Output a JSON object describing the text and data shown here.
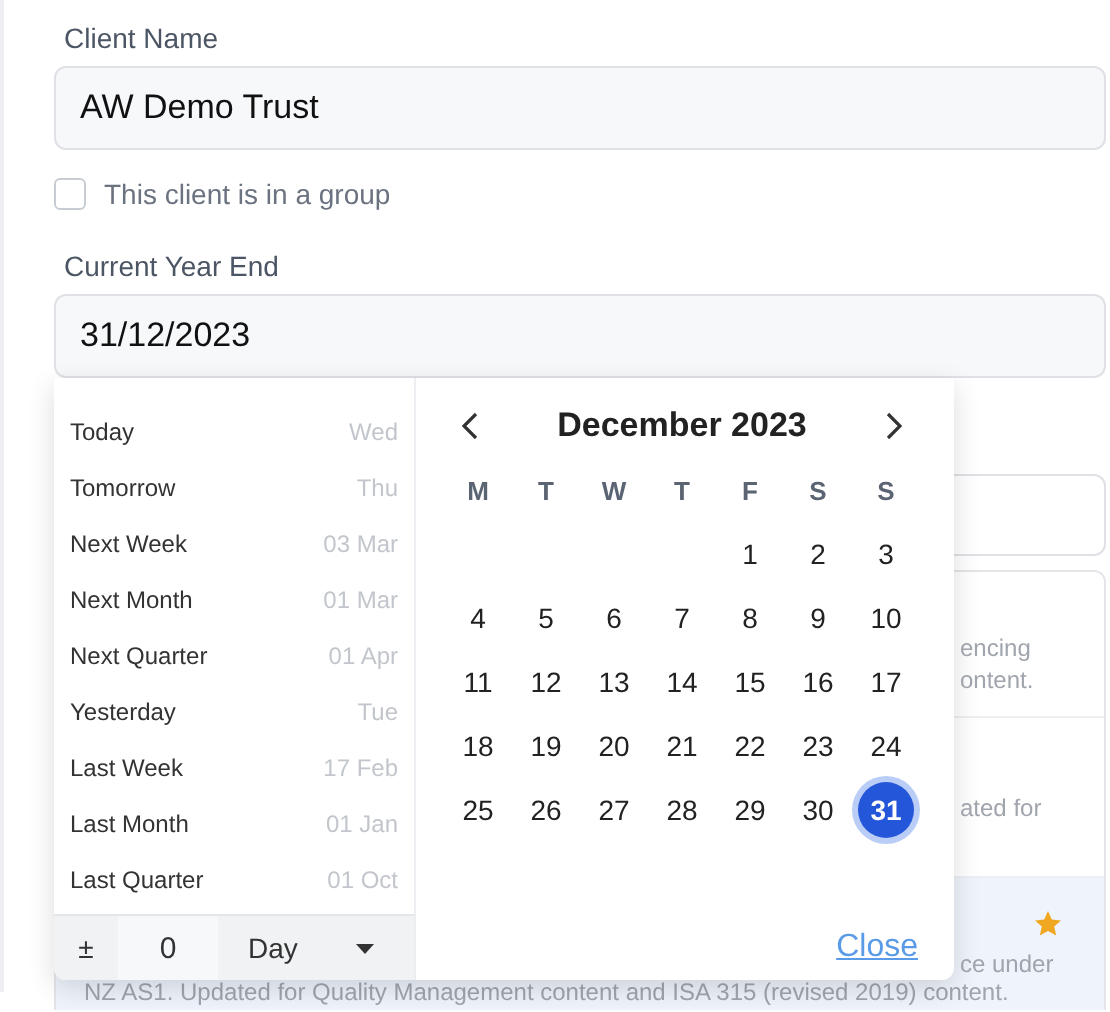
{
  "client_name": {
    "label": "Client Name",
    "value": "AW Demo Trust"
  },
  "group_checkbox": {
    "label": "This client is in a group",
    "checked": false
  },
  "year_end": {
    "label": "Current Year End",
    "value": "31/12/2023"
  },
  "cards": [
    {
      "texts": [
        "encing",
        "ontent."
      ],
      "highlighted": false,
      "starred": false
    },
    {
      "texts": [
        "ated for"
      ],
      "highlighted": false,
      "starred": false
    },
    {
      "texts": [
        "ce under"
      ],
      "note": "NZ AS1. Updated for Quality Management content and ISA 315 (revised 2019) content.",
      "highlighted": true,
      "starred": true
    }
  ],
  "datepicker": {
    "shortcuts": [
      {
        "label": "Today",
        "hint": "Wed"
      },
      {
        "label": "Tomorrow",
        "hint": "Thu"
      },
      {
        "label": "Next Week",
        "hint": "03 Mar"
      },
      {
        "label": "Next Month",
        "hint": "01 Mar"
      },
      {
        "label": "Next Quarter",
        "hint": "01 Apr"
      },
      {
        "label": "Yesterday",
        "hint": "Tue"
      },
      {
        "label": "Last Week",
        "hint": "17 Feb"
      },
      {
        "label": "Last Month",
        "hint": "01 Jan"
      },
      {
        "label": "Last Quarter",
        "hint": "01 Oct"
      }
    ],
    "offset": {
      "sign": "±",
      "amount": "0",
      "unit": "Day"
    },
    "month_title": "December 2023",
    "weekdays": [
      "M",
      "T",
      "W",
      "T",
      "F",
      "S",
      "S"
    ],
    "weeks": [
      [
        {
          "day": "1",
          "selected": false
        },
        {
          "day": "2",
          "selected": false
        },
        {
          "day": "3",
          "selected": false
        }
      ],
      [
        {
          "day": "4",
          "selected": false
        },
        {
          "day": "5",
          "selected": false
        },
        {
          "day": "6",
          "selected": false
        },
        {
          "day": "7",
          "selected": false
        },
        {
          "day": "8",
          "selected": false
        },
        {
          "day": "9",
          "selected": false
        },
        {
          "day": "10",
          "selected": false
        }
      ],
      [
        {
          "day": "11",
          "selected": false
        },
        {
          "day": "12",
          "selected": false
        },
        {
          "day": "13",
          "selected": false
        },
        {
          "day": "14",
          "selected": false
        },
        {
          "day": "15",
          "selected": false
        },
        {
          "day": "16",
          "selected": false
        },
        {
          "day": "17",
          "selected": false
        }
      ],
      [
        {
          "day": "18",
          "selected": false
        },
        {
          "day": "19",
          "selected": false
        },
        {
          "day": "20",
          "selected": false
        },
        {
          "day": "21",
          "selected": false
        },
        {
          "day": "22",
          "selected": false
        },
        {
          "day": "23",
          "selected": false
        },
        {
          "day": "24",
          "selected": false
        }
      ],
      [
        {
          "day": "25",
          "selected": false
        },
        {
          "day": "26",
          "selected": false
        },
        {
          "day": "27",
          "selected": false
        },
        {
          "day": "28",
          "selected": false
        },
        {
          "day": "29",
          "selected": false
        },
        {
          "day": "30",
          "selected": false
        },
        {
          "day": "31",
          "selected": true
        }
      ]
    ],
    "close": "Close"
  }
}
